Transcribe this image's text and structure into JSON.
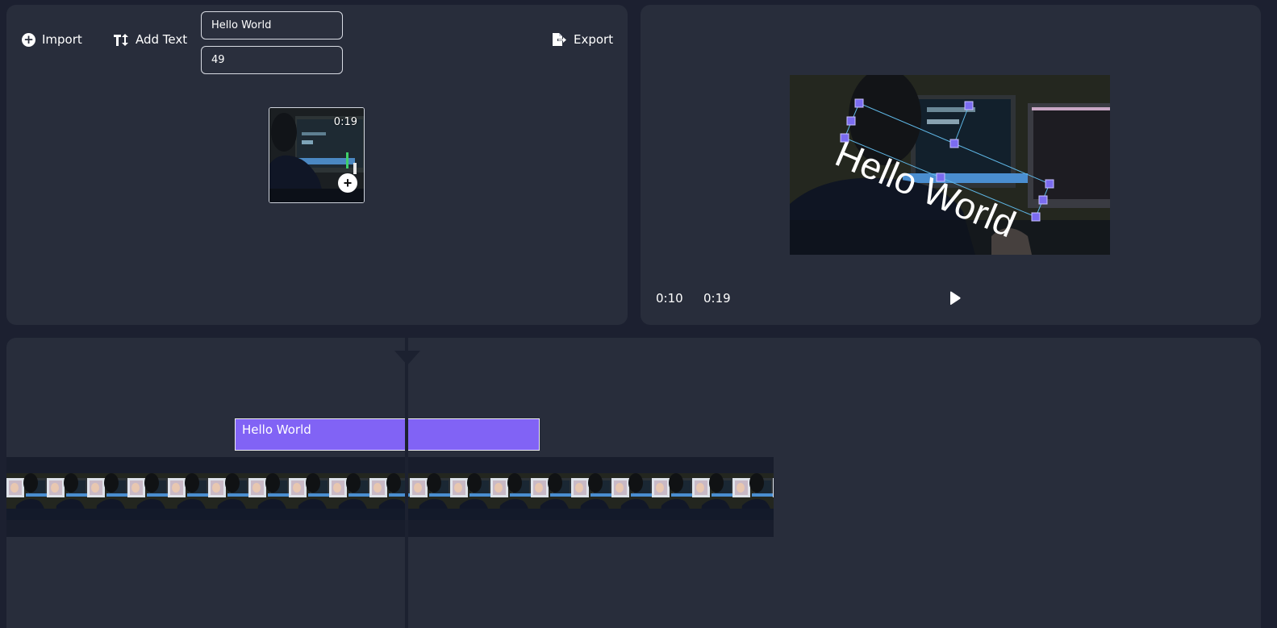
{
  "toolbar": {
    "import_label": "Import",
    "add_text_label": "Add Text",
    "export_label": "Export",
    "text_value": "Hello World",
    "size_value": "49"
  },
  "media": {
    "duration": "0:19",
    "add_symbol": "+"
  },
  "preview": {
    "overlay_text": "Hello World",
    "current_time": "0:10",
    "total_time": "0:19"
  },
  "timeline": {
    "text_clip_label": "Hello World"
  },
  "colors": {
    "panel": "#282d3b",
    "background": "#1c2030",
    "clip_accent": "#8163f5",
    "handle": "#7b6cf0",
    "selection_line": "#5fb7e6"
  },
  "icons": {
    "import": "plus-circle-icon",
    "add_text": "text-size-icon",
    "export": "export-file-icon",
    "play": "play-icon"
  }
}
